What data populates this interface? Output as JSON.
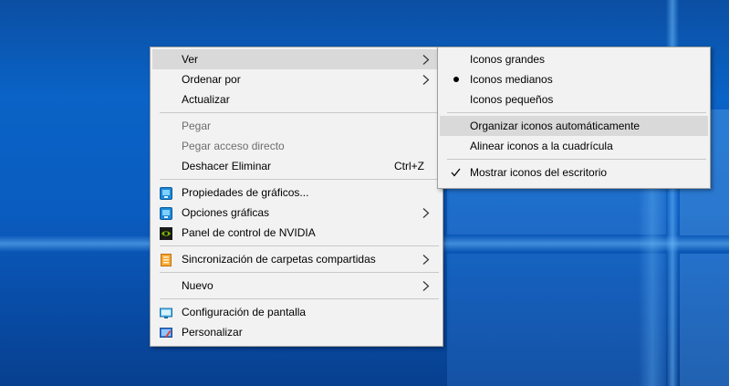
{
  "colors": {
    "desktop_blue": "#0a5cc0",
    "menu_bg": "#f2f2f2",
    "highlight": "#d9d9d9",
    "disabled_text": "#6d6d6d"
  },
  "context_menu": {
    "ver": "Ver",
    "ordenar_por": "Ordenar por",
    "actualizar": "Actualizar",
    "pegar": "Pegar",
    "pegar_acceso_directo": "Pegar acceso directo",
    "deshacer_eliminar": "Deshacer Eliminar",
    "deshacer_shortcut": "Ctrl+Z",
    "propiedades_graficos": "Propiedades de gráficos...",
    "opciones_graficas": "Opciones gráficas",
    "panel_nvidia": "Panel de control de NVIDIA",
    "sincronizacion": "Sincronización de carpetas compartidas",
    "nuevo": "Nuevo",
    "configuracion_pantalla": "Configuración de pantalla",
    "personalizar": "Personalizar"
  },
  "view_submenu": {
    "iconos_grandes": "Iconos grandes",
    "iconos_medianos": "Iconos medianos",
    "iconos_pequenos": "Iconos pequeños",
    "organizar": "Organizar iconos automáticamente",
    "alinear": "Alinear iconos a la cuadrícula",
    "mostrar": "Mostrar iconos del escritorio",
    "selected_size": "Iconos medianos",
    "checked_option": "Mostrar iconos del escritorio"
  }
}
